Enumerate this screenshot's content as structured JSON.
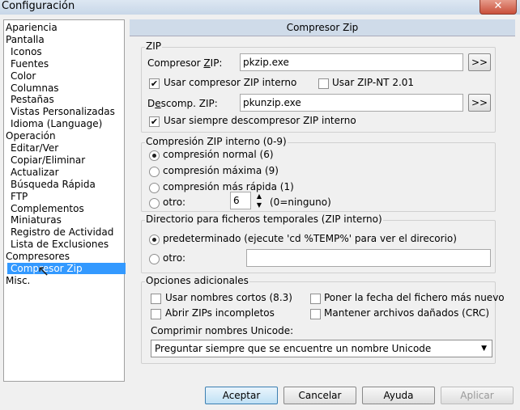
{
  "window": {
    "title": "Configuración",
    "close_glyph": "✕"
  },
  "tree": {
    "items": [
      {
        "label": "Apariencia",
        "level": 0
      },
      {
        "label": "Pantalla",
        "level": 0
      },
      {
        "label": "Iconos",
        "level": 1
      },
      {
        "label": "Fuentes",
        "level": 1
      },
      {
        "label": "Color",
        "level": 1
      },
      {
        "label": "Columnas",
        "level": 1
      },
      {
        "label": "Pestañas",
        "level": 1
      },
      {
        "label": "Vistas Personalizadas",
        "level": 1
      },
      {
        "label": "Idioma (Language)",
        "level": 1
      },
      {
        "label": "Operación",
        "level": 0
      },
      {
        "label": "Editar/Ver",
        "level": 1
      },
      {
        "label": "Copiar/Eliminar",
        "level": 1
      },
      {
        "label": "Actualizar",
        "level": 1
      },
      {
        "label": "Búsqueda Rápida",
        "level": 1
      },
      {
        "label": "FTP",
        "level": 1
      },
      {
        "label": "Complementos",
        "level": 1
      },
      {
        "label": "Miniaturas",
        "level": 1
      },
      {
        "label": "Registro de Actividad",
        "level": 1
      },
      {
        "label": "Lista de Exclusiones",
        "level": 1
      },
      {
        "label": "Compresores",
        "level": 0
      },
      {
        "label": "Compresor Zip",
        "level": 1,
        "selected": true
      },
      {
        "label": "Misc.",
        "level": 0
      }
    ]
  },
  "panel": {
    "header": "Compresor Zip"
  },
  "zip": {
    "group_title": "ZIP",
    "compressor_label_pre": "Compresor ",
    "compressor_label_u": "Z",
    "compressor_label_post": "IP:",
    "compressor_value": "pkzip.exe",
    "browse_label": ">>",
    "use_internal_label": "Usar compresor ZIP interno",
    "use_internal_checked": true,
    "use_zipnt_label": "Usar ZIP-NT 2.01",
    "use_zipnt_checked": false,
    "decomp_label_pre": "D",
    "decomp_label_u": "e",
    "decomp_label_post": "scomp. ZIP:",
    "decomp_value": "pkunzip.exe",
    "always_internal_label": "Usar siempre descompresor ZIP interno",
    "always_internal_checked": true
  },
  "compression": {
    "group_title": "Compresión ZIP interno (0-9)",
    "options": [
      "compresión normal (6)",
      "compresión máxima (9)",
      "compresión más rápida (1)",
      "otro:"
    ],
    "selected_index": 0,
    "other_value": "6",
    "other_hint": "(0=ninguno)"
  },
  "tempdir": {
    "group_title": "Directorio para ficheros temporales (ZIP interno)",
    "default_label": "predeterminado (ejecute 'cd %TEMP%' para ver el direcorio)",
    "other_label": "otro:",
    "other_value": "",
    "selected_index": 0
  },
  "additional": {
    "group_title": "Opciones adicionales",
    "short_names_label": "Usar nombres cortos (8.3)",
    "short_names_checked": false,
    "open_incomplete_label": "Abrir ZIPs incompletos",
    "open_incomplete_checked": false,
    "set_date_label": "Poner la fecha del fichero más nuevo",
    "set_date_checked": false,
    "keep_damaged_label": "Mantener archivos dañados (CRC)",
    "keep_damaged_checked": false,
    "unicode_label": "Comprimir nombres Unicode:",
    "unicode_value": "Preguntar siempre que se encuentre un nombre Unicode"
  },
  "buttons": {
    "accept": "Aceptar",
    "cancel": "Cancelar",
    "help": "Ayuda",
    "apply": "Aplicar"
  },
  "glyphs": {
    "check": "✔",
    "spin_up": "▲",
    "spin_down": "▼",
    "dropdown": "▼",
    "cursor": "↖"
  },
  "colors": {
    "selection": "#3399ff",
    "header_bg": "#cfdbe9",
    "default_button_border": "#3c7fb1"
  }
}
